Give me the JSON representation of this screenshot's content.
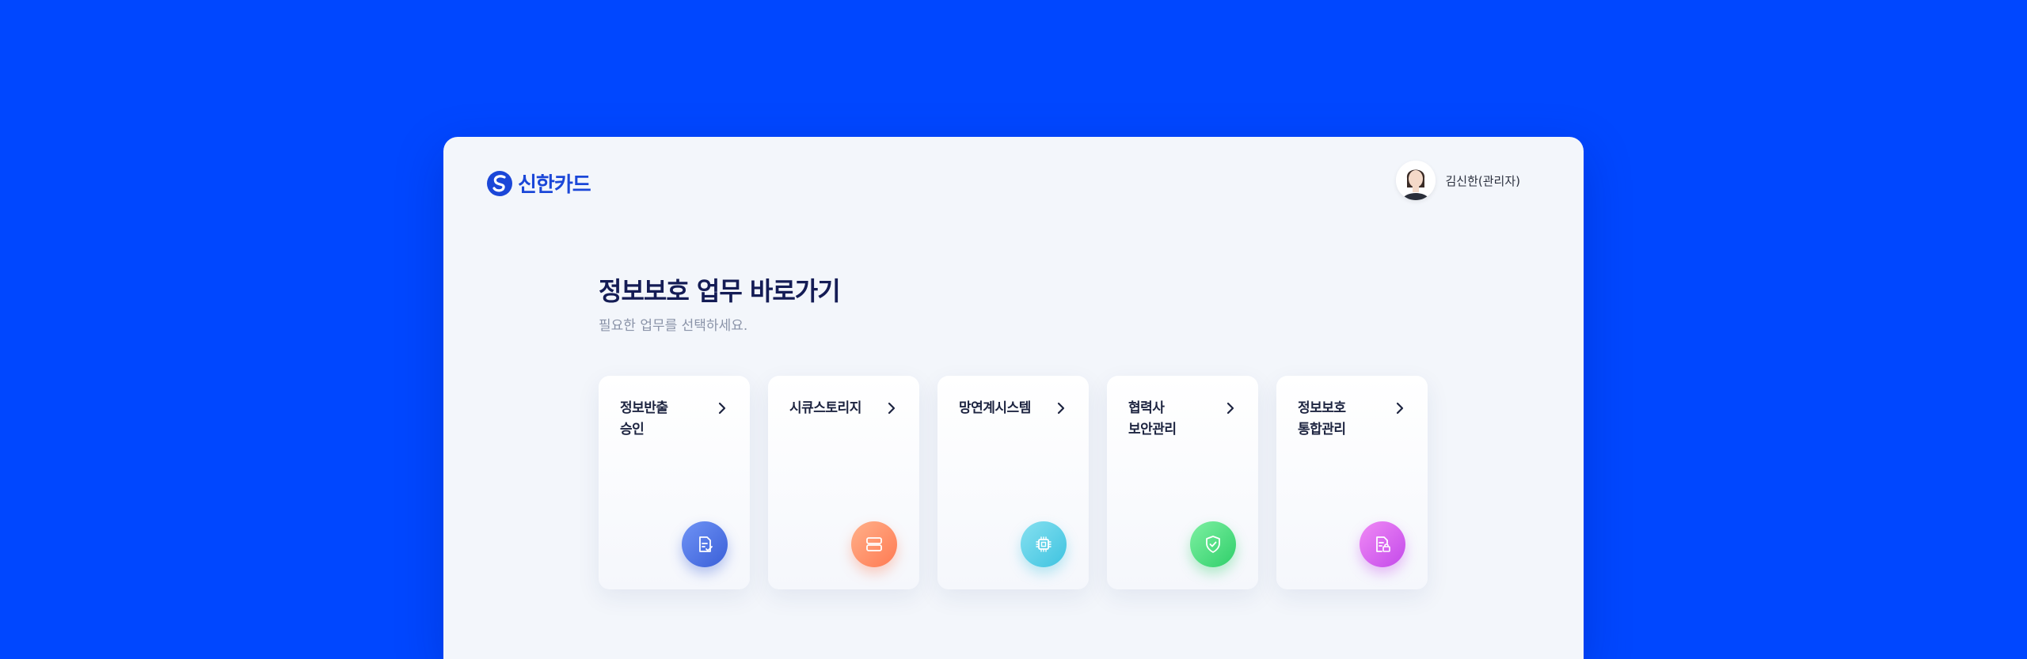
{
  "header": {
    "logo_text": "신한카드",
    "user_name": "김신한(관리자)"
  },
  "main": {
    "title": "정보보호 업무 바로가기",
    "subtitle": "필요한 업무를 선택하세요."
  },
  "cards": [
    {
      "label": "정보반출\n승인",
      "icon": "document-check-icon",
      "color_from": "#6f93f5",
      "color_to": "#3a5fd8"
    },
    {
      "label": "시큐스토리지",
      "icon": "storage-server-icon",
      "color_from": "#ffb08a",
      "color_to": "#ff7a52"
    },
    {
      "label": "망연계시스템",
      "icon": "chip-icon",
      "color_from": "#86e0f0",
      "color_to": "#3ec3e0"
    },
    {
      "label": "협력사\n보안관리",
      "icon": "shield-check-icon",
      "color_from": "#7ef0a2",
      "color_to": "#2fcf6a"
    },
    {
      "label": "정보보호\n통합관리",
      "icon": "document-lock-icon",
      "color_from": "#f08af5",
      "color_to": "#c349ea"
    }
  ]
}
